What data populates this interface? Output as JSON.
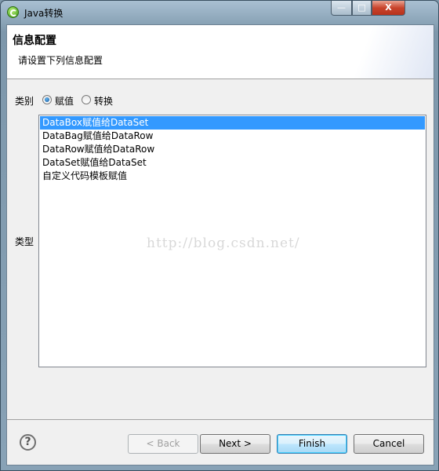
{
  "window": {
    "title": "Java转换",
    "minimize": "—",
    "maximize": "□",
    "close": "X"
  },
  "header": {
    "title": "信息配置",
    "description": "请设置下列信息配置"
  },
  "category": {
    "label": "类别",
    "options": [
      {
        "label": "赋值",
        "selected": true
      },
      {
        "label": "转换",
        "selected": false
      }
    ]
  },
  "type": {
    "label": "类型",
    "items": [
      "DataBox赋值给DataSet",
      "DataBag赋值给DataRow",
      "DataRow赋值给DataRow",
      "DataSet赋值给DataSet",
      "自定义代码模板赋值"
    ],
    "selected_index": 0
  },
  "watermark": "http://blog.csdn.net/",
  "footer": {
    "help": "?",
    "back": "< Back",
    "next": "Next >",
    "finish": "Finish",
    "cancel": "Cancel"
  },
  "colors": {
    "selection": "#3399ff",
    "default_button": "#3c7fb1"
  }
}
